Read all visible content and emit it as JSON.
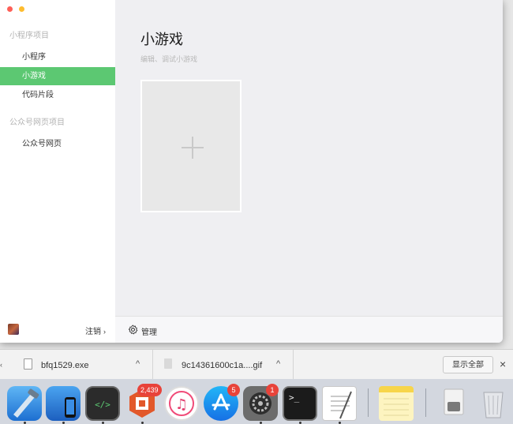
{
  "sidebar": {
    "section_miniprogram": "小程序项目",
    "items": [
      {
        "label": "小程序"
      },
      {
        "label": "小游戏"
      },
      {
        "label": "代码片段"
      }
    ],
    "section_web": "公众号网页项目",
    "web_item": "公众号网页",
    "logout": "注销",
    "logout_chevron": "›"
  },
  "main": {
    "title": "小游戏",
    "subtitle": "编辑、调试小游戏",
    "plus_icon": "plus-icon"
  },
  "footer": {
    "manage": "管理",
    "gear_icon": "gear-icon"
  },
  "downloads": {
    "items": [
      {
        "name": "bfq1529.exe",
        "chevron": "^"
      },
      {
        "name": "9c14361600c1a....gif",
        "chevron": "^"
      }
    ],
    "show_all": "显示全部",
    "close": "×"
  },
  "dock": {
    "apps": [
      {
        "name": "xcode",
        "badge": ""
      },
      {
        "name": "simulator",
        "badge": ""
      },
      {
        "name": "wechat-devtools",
        "badge": ""
      },
      {
        "name": "office-app",
        "badge": "2,439"
      },
      {
        "name": "itunes",
        "badge": ""
      },
      {
        "name": "app-store",
        "badge": "5"
      },
      {
        "name": "system-preferences",
        "badge": "1"
      },
      {
        "name": "terminal",
        "badge": ""
      },
      {
        "name": "textedit",
        "badge": ""
      },
      {
        "name": "notes",
        "badge": ""
      },
      {
        "name": "downloads-stack",
        "badge": ""
      },
      {
        "name": "trash",
        "badge": ""
      }
    ]
  },
  "colors": {
    "accent": "#5cc872",
    "badge": "#e8433a"
  }
}
